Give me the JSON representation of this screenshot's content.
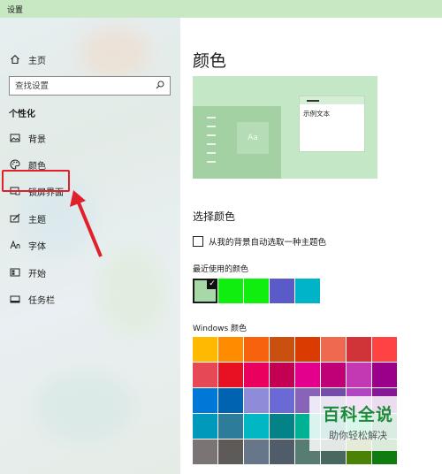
{
  "window": {
    "title": "设置"
  },
  "sidebar": {
    "home_label": "主页",
    "search_placeholder": "查找设置",
    "section": "个性化",
    "items": [
      {
        "label": "背景",
        "icon": "picture-icon"
      },
      {
        "label": "颜色",
        "icon": "palette-icon"
      },
      {
        "label": "锁屏界面",
        "icon": "lockscreen-icon"
      },
      {
        "label": "主题",
        "icon": "brush-icon"
      },
      {
        "label": "字体",
        "icon": "font-icon"
      },
      {
        "label": "开始",
        "icon": "start-icon"
      },
      {
        "label": "任务栏",
        "icon": "taskbar-icon"
      }
    ]
  },
  "main": {
    "title": "颜色",
    "preview": {
      "sample_text": "示例文本",
      "tile_text": "Aa"
    },
    "choose_color_title": "选择颜色",
    "auto_pick_label": "从我的背景自动选取一种主题色",
    "recent_label": "最近使用的颜色",
    "recent_colors": [
      "#a8d8a8",
      "#10ee10",
      "#10ee10",
      "#5a5ac8",
      "#00b4c8"
    ],
    "recent_selected_index": 0,
    "windows_colors_label": "Windows 颜色",
    "windows_colors": [
      "#ffb900",
      "#ff8c00",
      "#f7630c",
      "#ca5010",
      "#da3b01",
      "#ef6950",
      "#d13438",
      "#ff4343",
      "#e74856",
      "#e81123",
      "#ea005e",
      "#c30052",
      "#e3008c",
      "#bf0077",
      "#c239b3",
      "#9a0089",
      "#0078d7",
      "#0063b1",
      "#8e8cd8",
      "#6b69d6",
      "#8764b8",
      "#744da9",
      "#b146c2",
      "#881798",
      "#0099bc",
      "#2d7d9a",
      "#00b7c3",
      "#038387",
      "#00b294",
      "#018574",
      "#00cc6a",
      "#10893e",
      "#7a7574",
      "#5d5a58",
      "#68768a",
      "#515c6b",
      "#567c73",
      "#486860",
      "#498205",
      "#107c10"
    ]
  },
  "watermark": {
    "title": "百科全说",
    "subtitle": "助你轻松解决"
  }
}
